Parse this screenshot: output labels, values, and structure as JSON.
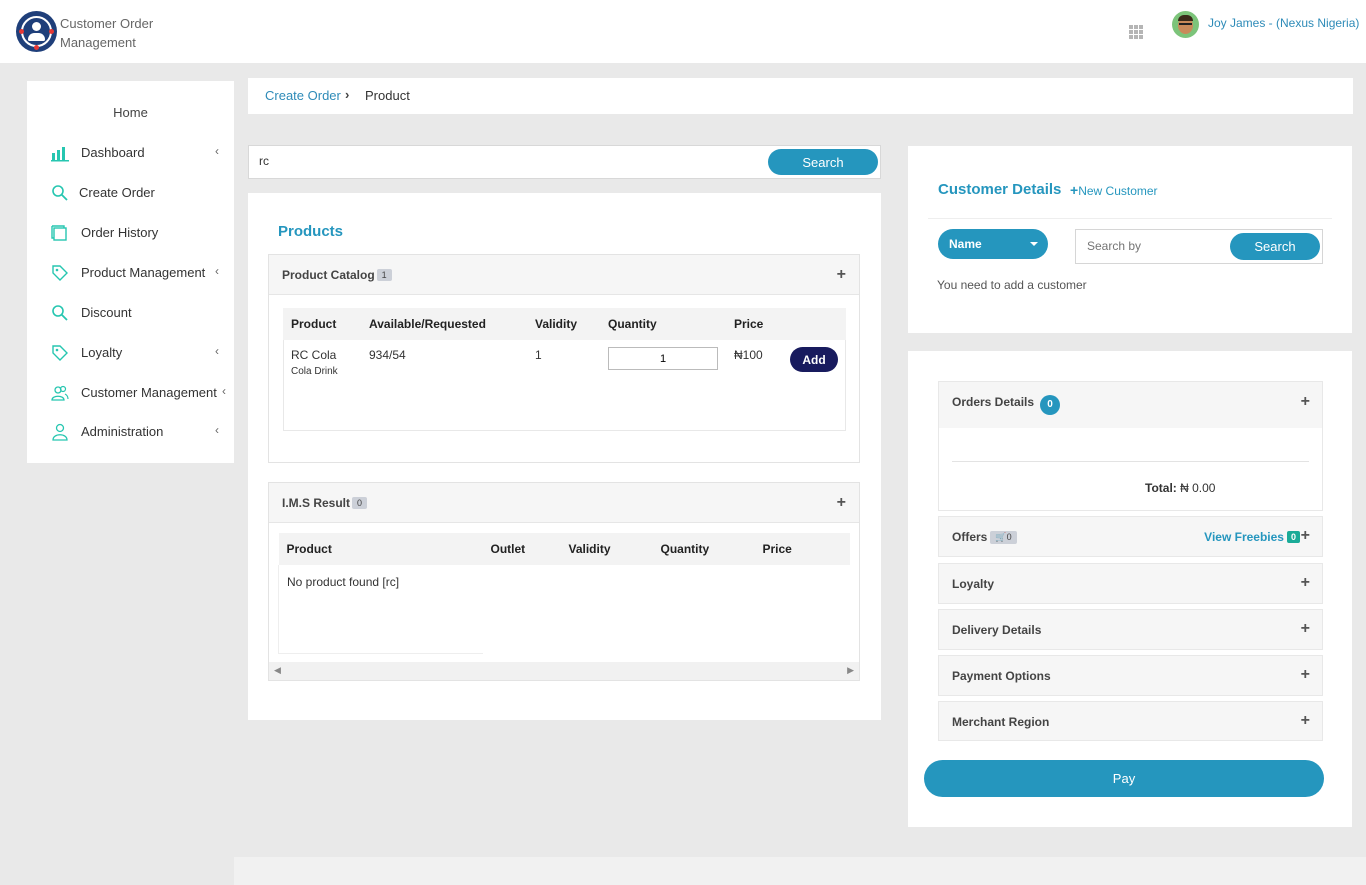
{
  "header": {
    "app_title_line1": "Customer Order",
    "app_title_line2": "Management",
    "user_name": "Joy James - (Nexus Nigeria)",
    "logo_icon": "logo-icon",
    "apps_icon": "grid-icon"
  },
  "sidebar": {
    "home": "Home",
    "items": [
      {
        "label": "Dashboard",
        "icon": "bar-chart-icon",
        "has_submenu": true
      },
      {
        "label": "Create Order",
        "icon": "search-icon",
        "has_submenu": false
      },
      {
        "label": "Order History",
        "icon": "book-icon",
        "has_submenu": false
      },
      {
        "label": "Product Management",
        "icon": "tag-icon",
        "has_submenu": true
      },
      {
        "label": "Discount",
        "icon": "search-icon",
        "has_submenu": false
      },
      {
        "label": "Loyalty",
        "icon": "tag-icon",
        "has_submenu": true
      },
      {
        "label": "Customer Management",
        "icon": "users-icon",
        "has_submenu": true
      },
      {
        "label": "Administration",
        "icon": "user-icon",
        "has_submenu": true
      }
    ]
  },
  "breadcrumb": {
    "parent": "Create Order",
    "current": "Product"
  },
  "product_search": {
    "value": "rc",
    "button": "Search"
  },
  "products": {
    "title": "Products",
    "catalog": {
      "title": "Product Catalog",
      "count": "1",
      "columns": [
        "Product",
        "Available/Requested",
        "Validity",
        "Quantity",
        "Price"
      ],
      "rows": [
        {
          "product": "RC Cola",
          "subtitle": "Cola Drink",
          "available": "934/54",
          "validity": "1",
          "quantity": "1",
          "price": "₦100",
          "action": "Add"
        }
      ]
    },
    "ims": {
      "title": "I.M.S Result",
      "count": "0",
      "columns": [
        "Product",
        "Outlet",
        "Validity",
        "Quantity",
        "Price"
      ],
      "empty": "No product found [rc]"
    }
  },
  "customer": {
    "title": "Customer Details",
    "new_customer": "New Customer",
    "filter": "Name",
    "search_placeholder": "Search by",
    "search_button": "Search",
    "note": "You need to add a customer"
  },
  "order": {
    "details_title": "Orders Details",
    "details_count": "0",
    "total_label": "Total:",
    "total_value": "₦ 0.00",
    "offers": "Offers",
    "offers_count": "0",
    "view_freebies": "View Freebies",
    "freebies_count": "0",
    "sections": [
      "Loyalty",
      "Delivery Details",
      "Payment Options",
      "Merchant Region"
    ],
    "pay": "Pay"
  },
  "colors": {
    "accent": "#2596be",
    "add_button": "#181b5e",
    "logo": "#1f3f7a"
  }
}
